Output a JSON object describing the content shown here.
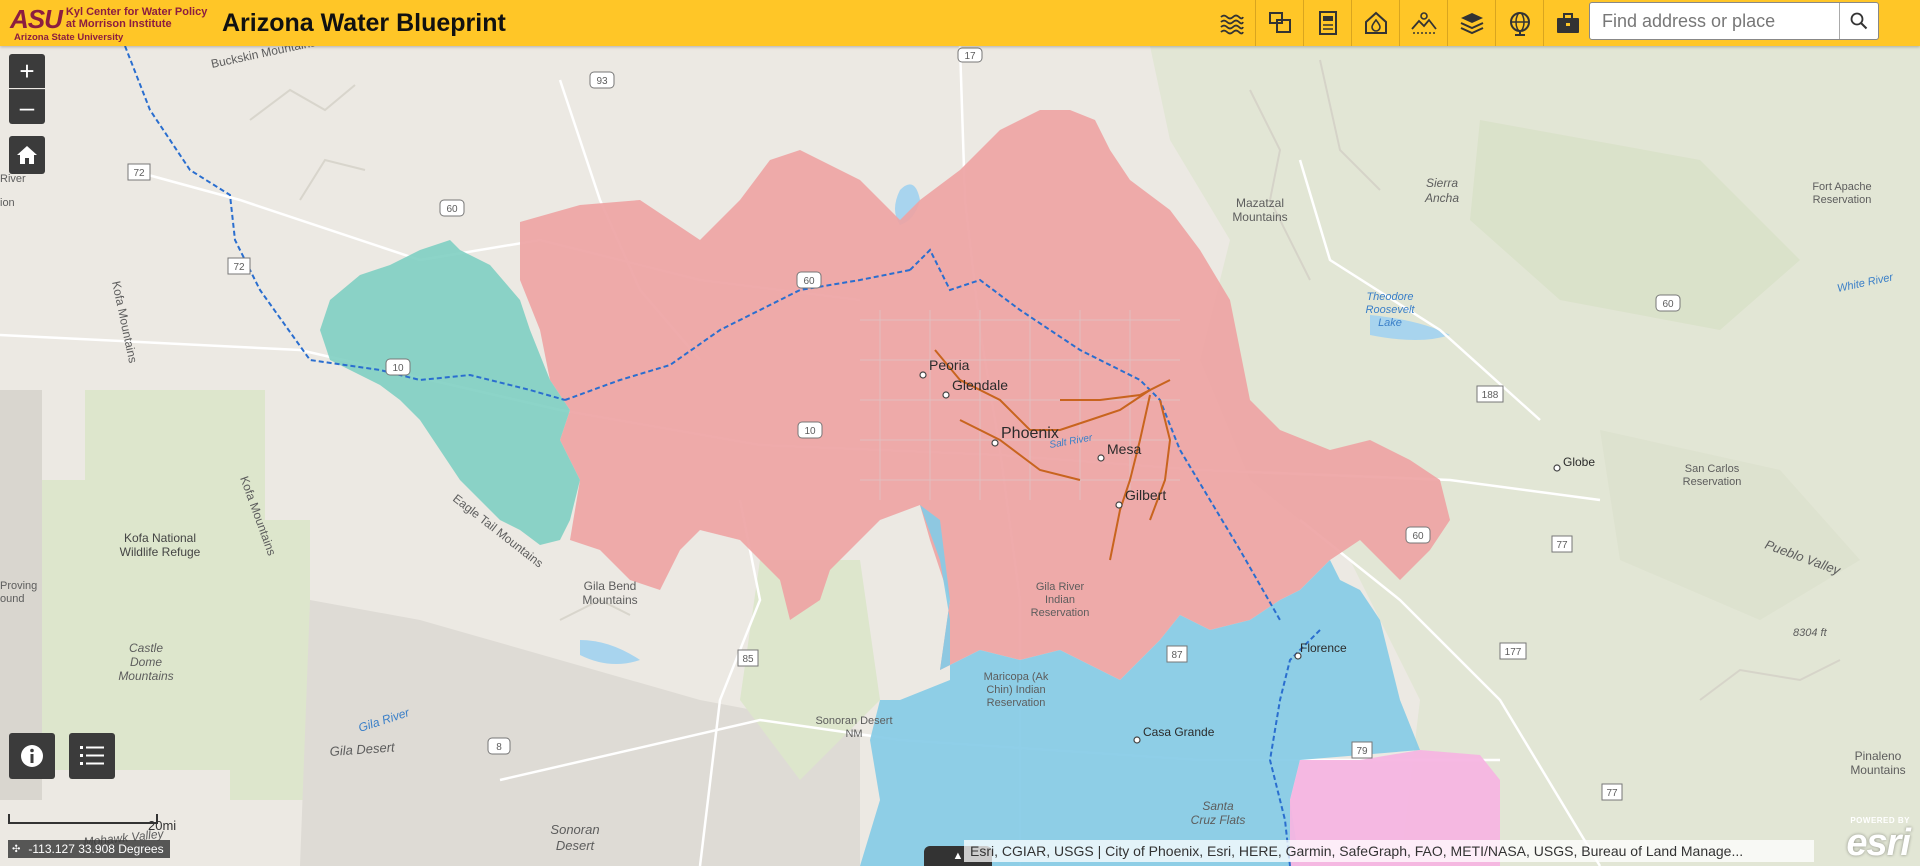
{
  "header": {
    "logo_mark": "ASU",
    "logo_line1": "Kyl Center for Water Policy",
    "logo_line2": "at Morrison Institute",
    "logo_sub": "Arizona State University",
    "title": "Arizona Water Blueprint",
    "colors": {
      "header_bg": "#ffc627",
      "brand_maroon": "#8c1d40"
    },
    "tools": [
      {
        "icon": "water-waves-icon"
      },
      {
        "icon": "layers-squares-icon"
      },
      {
        "icon": "document-icon"
      },
      {
        "icon": "water-drop-home-icon"
      },
      {
        "icon": "desert-landscape-icon"
      },
      {
        "icon": "layer-stack-icon"
      },
      {
        "icon": "globe-icon"
      },
      {
        "icon": "toolbox-icon"
      }
    ],
    "search": {
      "placeholder": "Find address or place",
      "icon": "search-icon"
    }
  },
  "map": {
    "controls": {
      "zoom_in": "+",
      "zoom_out": "–",
      "home_icon": "home-icon",
      "info_icon": "info-icon",
      "legend_icon": "list-icon"
    },
    "scale": {
      "label": "20mi"
    },
    "coordinates": "-113.127 33.908 Degrees",
    "attribution": "Esri, CGIAR, USGS | City of Phoenix, Esri, HERE, Garmin, SafeGraph, FAO, METI/NASA, USGS, Bureau of Land Manage...",
    "esri": {
      "powered_by": "POWERED BY",
      "logo": "esri"
    },
    "region_colors": {
      "pink": "#eea4a4",
      "teal": "#7fcfc2",
      "blue": "#86cbe6",
      "magenta": "#f5b5e2",
      "park": "#dde6cc"
    },
    "cities": {
      "peoria": "Peoria",
      "glendale": "Glendale",
      "phoenix": "Phoenix",
      "mesa": "Mesa",
      "gilbert": "Gilbert",
      "globe": "Globe",
      "florence": "Florence",
      "casa_grande": "Casa Grande"
    },
    "labels": {
      "buckskin": "Buckskin Mountains",
      "kofa_mtns_left": "Kofa Mountains",
      "kofa_mtns_right": "Kofa Mountains",
      "kofa_nwr_1": "Kofa National",
      "kofa_nwr_2": "Wildlife Refuge",
      "castle_1": "Castle",
      "castle_2": "Dome",
      "castle_3": "Mountains",
      "eagle_tail": "Eagle Tail Mountains",
      "gila_bend_1": "Gila Bend",
      "gila_bend_2": "Mountains",
      "gila_river_ind_1": "Gila River",
      "gila_river_ind_2": "Indian",
      "gila_river_ind_3": "Reservation",
      "maricopa_1": "Maricopa (Ak",
      "maricopa_2": "Chin) Indian",
      "maricopa_3": "Reservation",
      "sonoran_nm_1": "Sonoran Desert",
      "sonoran_nm_2": "NM",
      "gila_river": "Gila River",
      "gila_desert": "Gila Desert",
      "sonoran_desert_1": "Sonoran",
      "sonoran_desert_2": "Desert",
      "santa_cruz_1": "Santa",
      "santa_cruz_2": "Cruz Flats",
      "mohawk": "Mohawk Valley",
      "mazatzal_1": "Mazatzal",
      "mazatzal_2": "Mountains",
      "sierra_1": "Sierra",
      "sierra_2": "Ancha",
      "theodore_1": "Theodore",
      "theodore_2": "Roosevelt",
      "theodore_3": "Lake",
      "fort_apache_1": "Fort Apache",
      "fort_apache_2": "Reservation",
      "white_river": "White River",
      "san_carlos_1": "San Carlos",
      "san_carlos_2": "Reservation",
      "pueblo_valley": "Pueblo Valley",
      "elev_8304": "8304 ft",
      "pinaleno_1": "Pinaleno",
      "pinaleno_2": "Mountains",
      "salt_river": "Salt River",
      "river_edge": "River",
      "ion_edge": "ion",
      "proving_1": "Proving",
      "proving_2": "ound"
    },
    "highways": {
      "us93": "93",
      "i17": "17",
      "us72a": "72",
      "us72b": "72",
      "us60a": "60",
      "us60b": "60",
      "us60c": "60",
      "us60d": "60",
      "i10a": "10",
      "i10b": "10",
      "sr85": "85",
      "i8": "8",
      "sr87": "87",
      "sr188": "188",
      "sr77a": "77",
      "sr77b": "77",
      "sr177": "177",
      "sr79": "79"
    }
  }
}
